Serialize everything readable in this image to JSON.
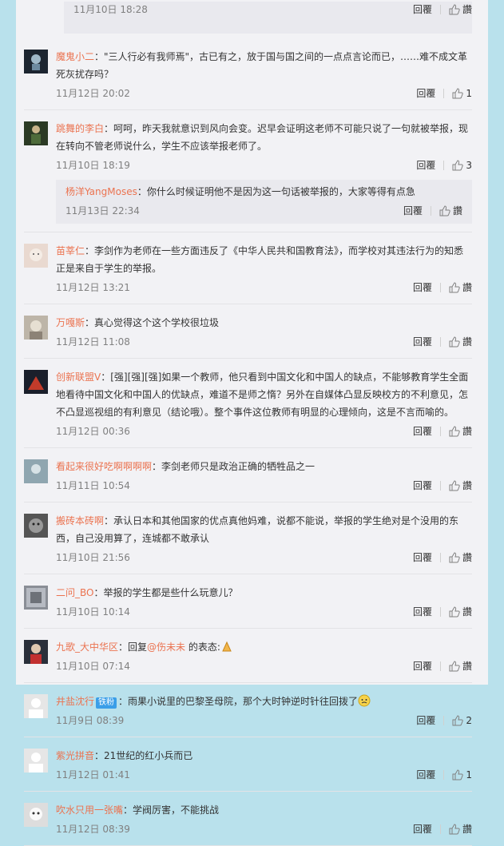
{
  "comments": [
    {
      "user": "",
      "text": "",
      "time": "11月10日 18:28",
      "reply": "回覆",
      "likes": "讚",
      "is_reply": true,
      "partial": true
    },
    {
      "user": "魔鬼小二",
      "text": "：\"三人行必有我师焉\"，古已有之，放于国与国之间的一点点言论而已，……难不成文革死灰扰存吗？",
      "time": "11月12日 20:02",
      "reply": "回覆",
      "likes": "1"
    },
    {
      "user": "跳舞的李白",
      "text": "：呵呵，昨天我就意识到风向会变。迟早会证明这老师不可能只说了一句就被举报，现在转向不管老师说什么，学生不应该举报老师了。",
      "time": "11月10日 18:19",
      "reply": "回覆",
      "likes": "3"
    },
    {
      "user": "杨洋YangMoses",
      "text": "：你什么时候证明他不是因为这一句话被举报的，大家等得有点急",
      "time": "11月13日 22:34",
      "reply": "回覆",
      "likes": "讚",
      "is_reply": true
    },
    {
      "user": "苗莘仁",
      "text": "：李剑作为老师在一些方面违反了《中华人民共和国教育法》，而学校对其违法行为的知悉正是来自于学生的举报。",
      "time": "11月12日 13:21",
      "reply": "回覆",
      "likes": "讚"
    },
    {
      "user": "万嘎斯",
      "text": "：真心觉得这个这个学校很垃圾",
      "time": "11月12日 11:08",
      "reply": "回覆",
      "likes": "讚"
    },
    {
      "user": "创新联盟V",
      "text": "：[强][强][强]如果一个教师，他只看到中国文化和中国人的缺点，不能够教育学生全面地看待中国文化和中国人的优缺点，难道不是师之惰？另外在自媒体凸显反映校方的不利意见，怎不凸显巡视组的有利意见（结论哦）。整个事件这位教师有明显的心理倾向，这是不言而喻的。",
      "time": "11月12日 00:36",
      "reply": "回覆",
      "likes": "讚"
    },
    {
      "user": "看起来很好吃啊啊啊啊",
      "text": "：李剑老师只是政治正确的牺牲品之一",
      "time": "11月11日 10:54",
      "reply": "回覆",
      "likes": "讚"
    },
    {
      "user": "搬砖本砖啊",
      "text": "：承认日本和其他国家的优点真他妈难，说都不能说，举报的学生绝对是个没用的东西，自己没用算了，连城都不敢承认",
      "time": "11月10日 21:56",
      "reply": "回覆",
      "likes": "讚"
    },
    {
      "user": "二问_BO",
      "text": "：举报的学生都是些什么玩意儿？",
      "time": "11月10日 10:14",
      "reply": "回覆",
      "likes": "讚"
    },
    {
      "user": "九歌_大中华区",
      "text_pre": "：回复",
      "at": "@伤未未",
      "text_post": " 的表态:",
      "time": "11月10日 07:14",
      "reply": "回覆",
      "likes": "讚",
      "emoji": "pray"
    },
    {
      "user": "井盐沈行",
      "badge": "铁粉",
      "text": "：雨果小说里的巴黎圣母院，那个大时钟逆时针往回拨了",
      "time": "11月9日 08:39",
      "reply": "回覆",
      "likes": "2",
      "emoji": "cry"
    },
    {
      "user": "紫光拼音",
      "text": "：21世纪的红小兵而已",
      "time": "11月12日 01:41",
      "reply": "回覆",
      "likes": "1"
    },
    {
      "user": "吹水只用一张嘴",
      "text": "：学阀厉害，不能挑战",
      "time": "11月12日 08:39",
      "reply": "回覆",
      "likes": "讚"
    }
  ],
  "colors": {
    "username": "#eb7350",
    "background": "#b9e1ec",
    "panel": "#f2f2f5"
  }
}
